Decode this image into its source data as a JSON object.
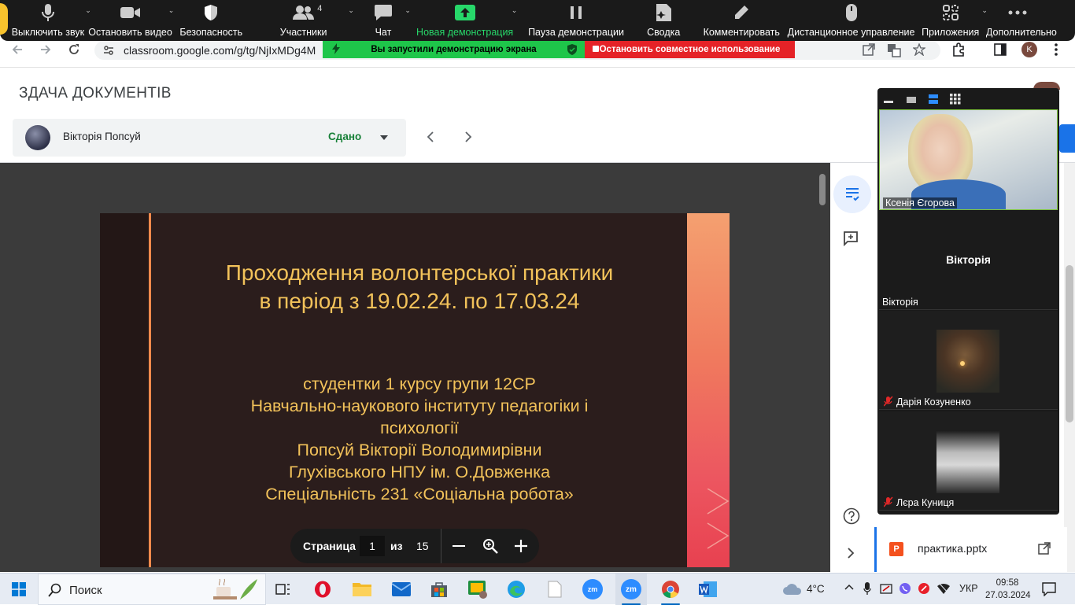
{
  "zoom_toolbar": {
    "items": [
      {
        "label": "Выключить звук",
        "icon": "microphone-icon"
      },
      {
        "label": "Остановить видео",
        "icon": "video-camera-icon"
      },
      {
        "label": "Безопасность",
        "icon": "shield-icon"
      },
      {
        "label": "Участники",
        "icon": "participants-icon",
        "count": "4"
      },
      {
        "label": "Чат",
        "icon": "chat-icon"
      },
      {
        "label": "Новая демонстрация",
        "icon": "share-screen-icon"
      },
      {
        "label": "Пауза демонстрации",
        "icon": "pause-icon"
      },
      {
        "label": "Сводка",
        "icon": "summary-icon"
      },
      {
        "label": "Комментировать",
        "icon": "pencil-icon"
      },
      {
        "label": "Дистанционное управление",
        "icon": "mouse-icon"
      },
      {
        "label": "Приложения",
        "icon": "apps-icon"
      },
      {
        "label": "Дополнительно",
        "icon": "more-icon"
      }
    ],
    "accent": "#27d86a"
  },
  "share_banner": {
    "status": "Вы запустили демонстрацию экрана",
    "stop_label": "Остановить совместное использование"
  },
  "browser": {
    "url": "classroom.google.com/g/tg/NjIxMDg4M"
  },
  "classroom": {
    "page_title": "ЗДАЧА ДОКУМЕНТІВ",
    "student_name": "Вікторія Попсуй",
    "status": "Сдано",
    "status_color": "#188038"
  },
  "slide": {
    "title_line1": "Проходження волонтерської практики",
    "title_line2": "в період з 19.02.24. по 17.03.24",
    "body_lines": [
      "студентки 1 курсу групи 12СР",
      "Навчально-наукового інституту педагогіки і",
      "психології",
      "Попсуй Вікторії Володимирівни",
      "Глухівського НПУ ім. О.Довженка",
      "Спеціальність 231 «Соціальна робота»"
    ],
    "title_color": "#f2c25a"
  },
  "pager": {
    "page_label": "Страница",
    "current_page": "1",
    "of_label": "из",
    "total_pages": "15"
  },
  "attachment": {
    "file_name": "практика.pptx"
  },
  "gallery": {
    "participants": [
      {
        "name": "Ксенія Єгорова",
        "muted": false
      },
      {
        "name": "Вікторія",
        "display": "Вікторія",
        "muted": false
      },
      {
        "name": "Дарія Козуненко",
        "muted": true
      },
      {
        "name": "Лєра Куниця",
        "muted": true
      }
    ]
  },
  "taskbar": {
    "search_placeholder": "Поиск",
    "weather": "4°C",
    "language": "УКР",
    "time": "09:58",
    "date": "27.03.2024"
  }
}
